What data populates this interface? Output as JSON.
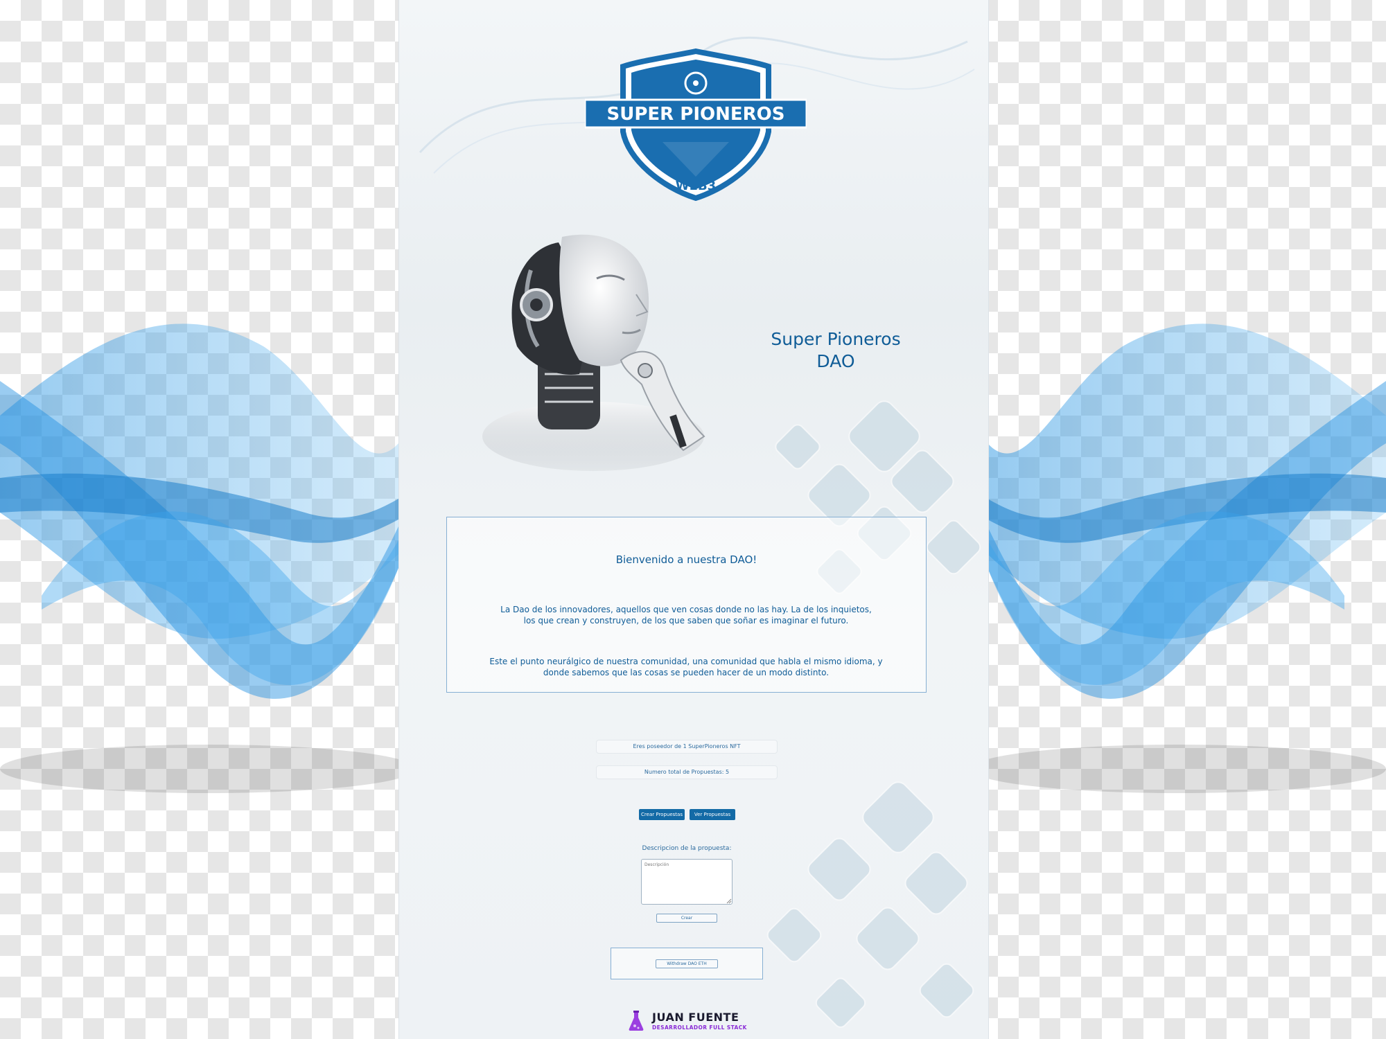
{
  "logo": {
    "brand": "SUPER PIONEROS",
    "sub": "WEB3"
  },
  "hero": {
    "title_line1": "Super Pioneros",
    "title_line2": "DAO"
  },
  "welcome": {
    "heading": "Bienvenido a nuestra DAO!",
    "paragraph1_line1": "La Dao de los innovadores, aquellos que ven cosas donde no las hay. La de los inquietos,",
    "paragraph1_line2": "los que crean y construyen, de los que saben que soñar es imaginar el futuro.",
    "paragraph2_line1": "Este el punto neurálgico de nuestra comunidad, una comunidad que habla el mismo idioma, y",
    "paragraph2_line2": "donde sabemos que las cosas se pueden hacer de un modo distinto."
  },
  "status": {
    "nft_owner": "Eres poseedor de 1 SuperPioneros NFT",
    "proposals_total": "Numero total de Propuestas: 5"
  },
  "actions": {
    "create_label": "Crear Propuestas",
    "view_label": "Ver Propuestas"
  },
  "proposal_form": {
    "label": "Descripcion de la propuesta:",
    "placeholder": "Descripción",
    "submit_label": "Crear"
  },
  "withdraw": {
    "label": "Withdraw DAO ETH"
  },
  "signature": {
    "name": "JUAN FUENTE",
    "role": "DESARROLLADOR FULL STACK"
  },
  "colors": {
    "primary": "#136aa6",
    "text": "#0f5c97",
    "wave": "#1e90e0",
    "signature_accent": "#8a2bd6"
  }
}
